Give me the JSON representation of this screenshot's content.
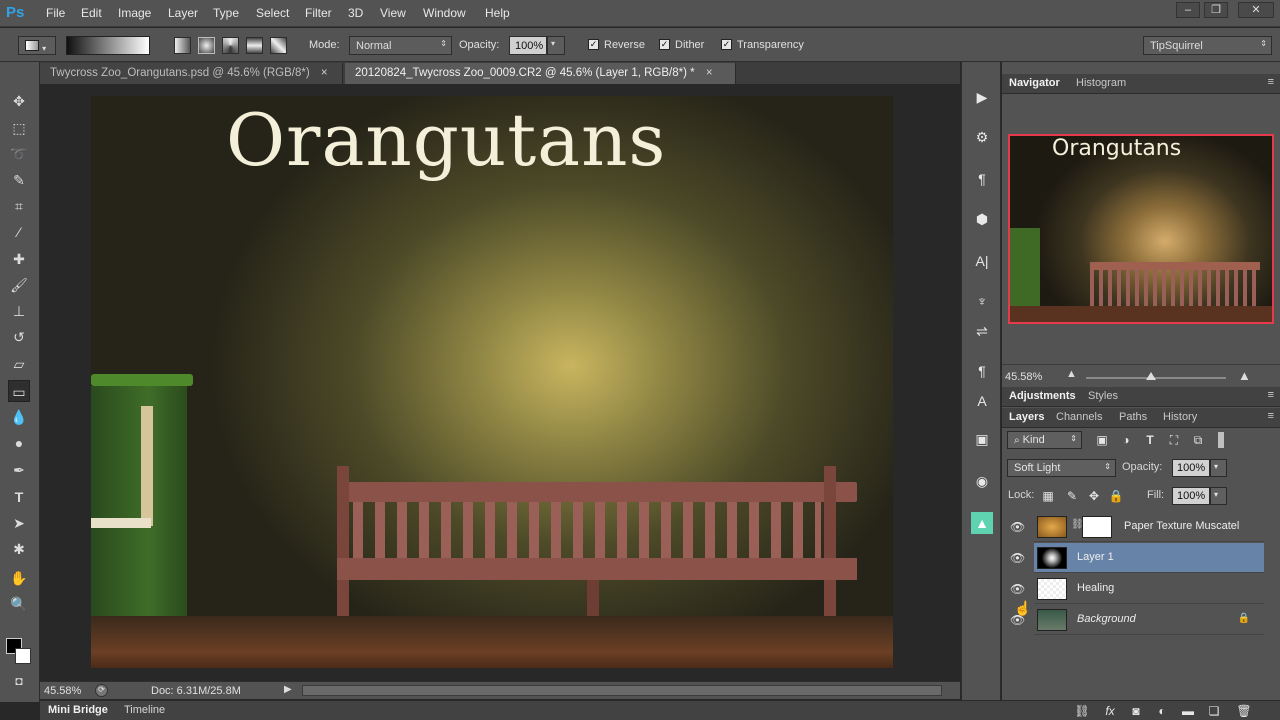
{
  "app": {
    "logo": "Ps",
    "menu": [
      "File",
      "Edit",
      "Image",
      "Layer",
      "Type",
      "Select",
      "Filter",
      "3D",
      "View",
      "Window",
      "Help"
    ]
  },
  "options": {
    "mode_label": "Mode:",
    "mode_value": "Normal",
    "opacity_label": "Opacity:",
    "opacity_value": "100%",
    "reverse_label": "Reverse",
    "dither_label": "Dither",
    "transparency_label": "Transparency",
    "workspace": "TipSquirrel"
  },
  "tabs": [
    {
      "label": "Twycross Zoo_Orangutans.psd @ 45.6% (RGB/8*)",
      "close": "×"
    },
    {
      "label": "20120824_Twycross Zoo_0009.CR2 @ 45.6% (Layer 1, RGB/8*) *",
      "close": "×"
    }
  ],
  "canvas": {
    "title": "Orangutans"
  },
  "status": {
    "zoom": "45.58%",
    "doc": "Doc: 6.31M/25.8M"
  },
  "bottom_tabs": [
    "Mini Bridge",
    "Timeline"
  ],
  "navigator": {
    "tabs": [
      "Navigator",
      "Histogram"
    ],
    "preview_title": "Orangutans",
    "zoom": "45.58%"
  },
  "adjustments": {
    "tabs": [
      "Adjustments",
      "Styles"
    ]
  },
  "layers_panel": {
    "tabs": [
      "Layers",
      "Channels",
      "Paths",
      "History"
    ],
    "filter_kind": "Kind",
    "blend_mode": "Soft Light",
    "opacity_label": "Opacity:",
    "opacity_value": "100%",
    "lock_label": "Lock:",
    "fill_label": "Fill:",
    "fill_value": "100%",
    "layers": [
      {
        "name": "Paper Texture Muscatel",
        "selected": false
      },
      {
        "name": "Layer 1",
        "selected": true
      },
      {
        "name": "Healing",
        "selected": false
      },
      {
        "name": "Background",
        "selected": false
      }
    ]
  },
  "colors": {
    "accent": "#2fa3e6",
    "selection": "#6883a8",
    "navigator_frame": "#e43a4c"
  }
}
